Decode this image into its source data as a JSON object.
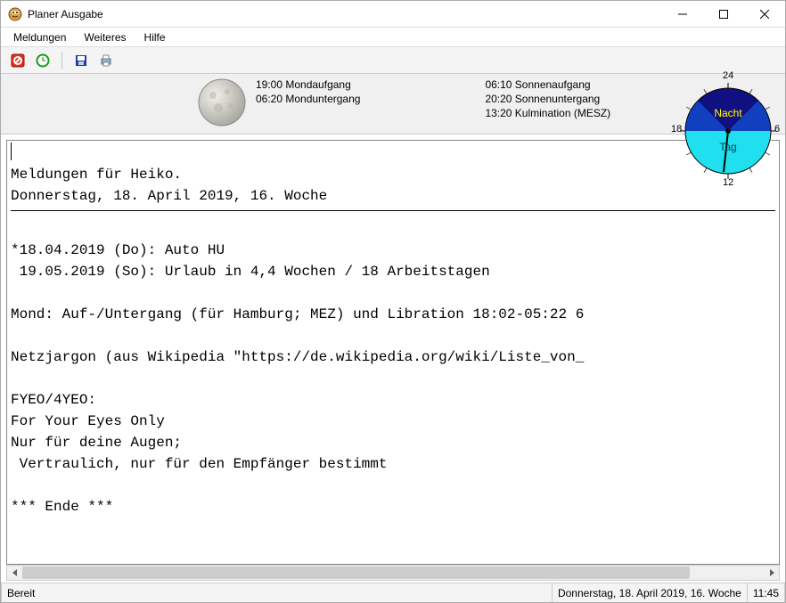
{
  "window": {
    "title": "Planer Ausgabe"
  },
  "menu": {
    "items": [
      "Meldungen",
      "Weiteres",
      "Hilfe"
    ]
  },
  "toolbar": {
    "icons": [
      "stop-icon",
      "clock-icon",
      "save-icon",
      "print-icon"
    ]
  },
  "astro": {
    "moon_rise_label": "19:00 Mondaufgang",
    "moon_set_label": "06:20 Monduntergang",
    "sun_rise_label": "06:10 Sonnenaufgang",
    "sun_set_label": "20:20 Sonnenuntergang",
    "culmination_label": "13:20 Kulmination (MESZ)",
    "clock": {
      "top": "24",
      "right": "6",
      "bottom": "12",
      "left": "18",
      "night_label": "Nacht",
      "day_label": "Tag"
    }
  },
  "content": {
    "line_header1": "Meldungen für Heiko.",
    "line_header2": "Donnerstag, 18. April 2019, 16. Woche",
    "line_ev1": "*18.04.2019 (Do): Auto HU",
    "line_ev2": " 19.05.2019 (So): Urlaub in 4,4 Wochen / 18 Arbeitstagen",
    "line_moon": "Mond: Auf-/Untergang (für Hamburg; MEZ) und Libration 18:02-05:22 6",
    "line_wiki": "Netzjargon (aus Wikipedia \"https://de.wikipedia.org/wiki/Liste_von_",
    "line_f1": "FYEO/4YEO:",
    "line_f2": "For Your Eyes Only",
    "line_f3": "Nur für deine Augen;",
    "line_f4": " Vertraulich, nur für den Empfänger bestimmt",
    "line_end": "*** Ende ***"
  },
  "status": {
    "left": "Bereit",
    "date": "Donnerstag, 18. April 2019, 16. Woche",
    "time": "11:45"
  }
}
